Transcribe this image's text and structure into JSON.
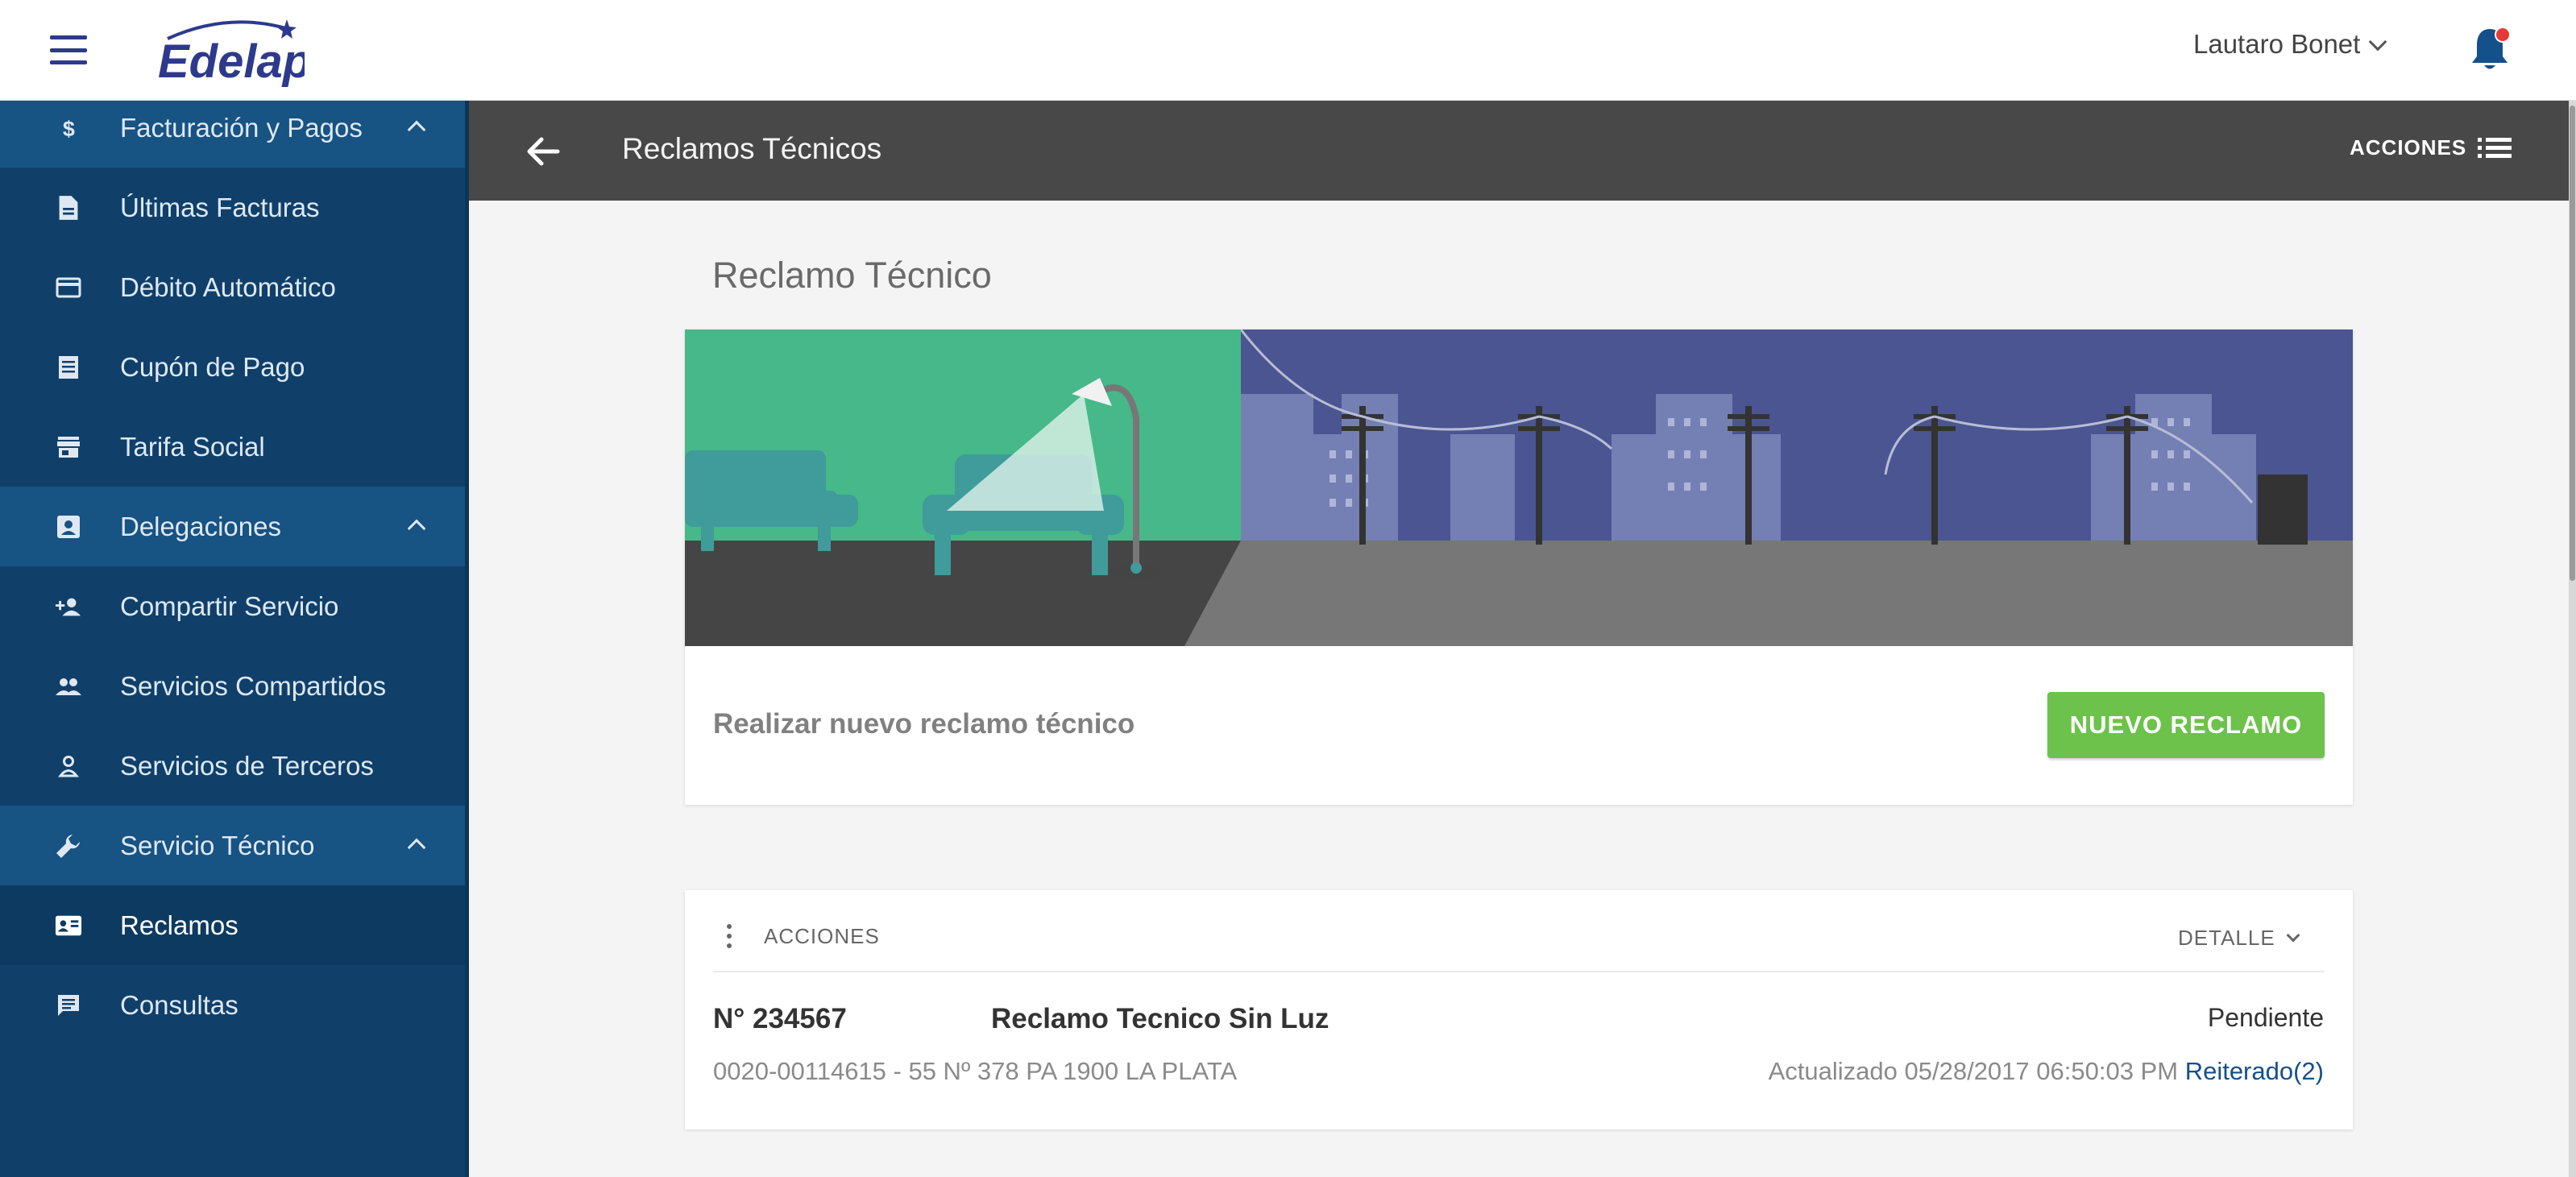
{
  "header": {
    "logo_text": "Edelap",
    "user_name": "Lautaro Bonet",
    "colors": {
      "brand": "#2d3a8c",
      "notification_dot": "#e53935"
    }
  },
  "sidebar": {
    "colors": {
      "background": "#10406a",
      "section": "#175383",
      "active": "#0d3a60"
    },
    "items": [
      {
        "label": "Facturación y Pagos",
        "icon": "dollar-icon",
        "type": "section",
        "expanded": true
      },
      {
        "label": "Últimas Facturas",
        "icon": "document-icon",
        "type": "item"
      },
      {
        "label": "Débito Automático",
        "icon": "credit-card-icon",
        "type": "item"
      },
      {
        "label": "Cupón de Pago",
        "icon": "receipt-icon",
        "type": "item"
      },
      {
        "label": "Tarifa Social",
        "icon": "store-icon",
        "type": "item"
      },
      {
        "label": "Delegaciones",
        "icon": "contact-card-icon",
        "type": "section",
        "expanded": true
      },
      {
        "label": "Compartir Servicio",
        "icon": "person-add-icon",
        "type": "item"
      },
      {
        "label": "Servicios Compartidos",
        "icon": "people-icon",
        "type": "item"
      },
      {
        "label": "Servicios de Terceros",
        "icon": "person-icon",
        "type": "item"
      },
      {
        "label": "Servicio Técnico",
        "icon": "wrench-icon",
        "type": "section",
        "expanded": true
      },
      {
        "label": "Reclamos",
        "icon": "contact-mail-icon",
        "type": "item",
        "active": true
      },
      {
        "label": "Consultas",
        "icon": "chat-icon",
        "type": "item"
      }
    ]
  },
  "page_header": {
    "title": "Reclamos Técnicos",
    "actions_label": "ACCIONES"
  },
  "main": {
    "section_title": "Reclamo Técnico",
    "new_claim": {
      "text": "Realizar nuevo reclamo técnico",
      "button_label": "NUEVO RECLAMO",
      "button_color": "#6cc24a"
    },
    "claim": {
      "actions_label": "ACCIONES",
      "detail_label": "DETALLE",
      "number": "N° 234567",
      "type": "Reclamo Tecnico Sin Luz",
      "status": "Pendiente",
      "address": "0020-00114615 - 55 Nº 378 PA 1900 LA PLATA",
      "updated": "Actualizado 05/28/2017 06:50:03 PM",
      "reiterado": "Reiterado(2)"
    }
  }
}
